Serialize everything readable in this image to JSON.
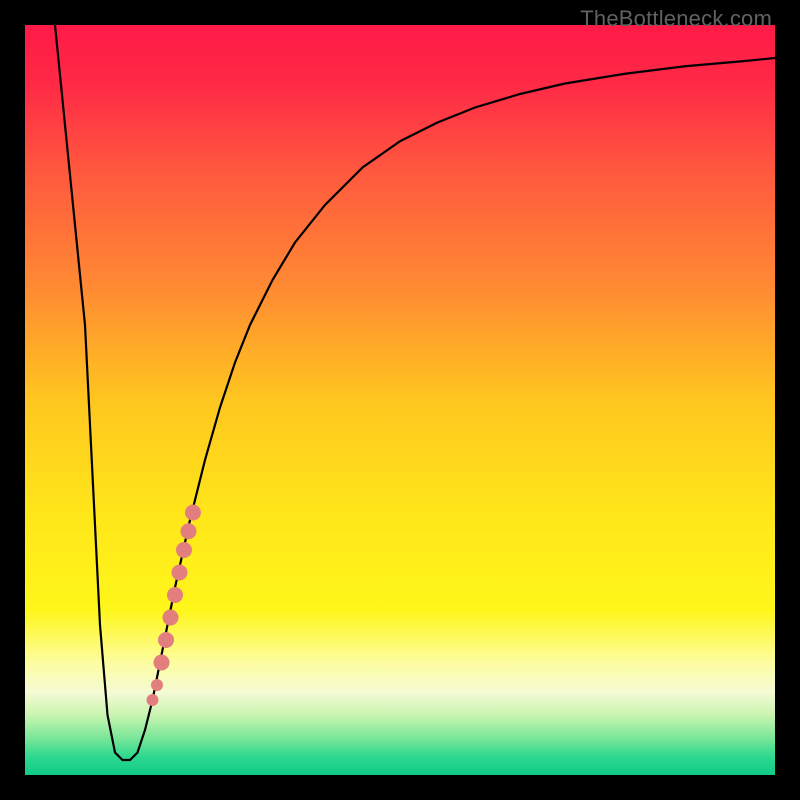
{
  "watermark": "TheBottleneck.com",
  "chart_data": {
    "type": "line",
    "title": "",
    "xlabel": "",
    "ylabel": "",
    "xlim": [
      0,
      100
    ],
    "ylim": [
      0,
      100
    ],
    "grid": false,
    "legend": false,
    "gradient_stops": [
      {
        "offset": 0.0,
        "color": "#ff1a47"
      },
      {
        "offset": 0.08,
        "color": "#ff2a46"
      },
      {
        "offset": 0.2,
        "color": "#ff5a3e"
      },
      {
        "offset": 0.35,
        "color": "#ff8a33"
      },
      {
        "offset": 0.5,
        "color": "#ffc61f"
      },
      {
        "offset": 0.65,
        "color": "#ffe61a"
      },
      {
        "offset": 0.78,
        "color": "#fff61a"
      },
      {
        "offset": 0.85,
        "color": "#fdfda0"
      },
      {
        "offset": 0.89,
        "color": "#f4fad4"
      },
      {
        "offset": 0.92,
        "color": "#c9f4b0"
      },
      {
        "offset": 0.95,
        "color": "#7ce79a"
      },
      {
        "offset": 0.975,
        "color": "#2fd98f"
      },
      {
        "offset": 1.0,
        "color": "#0fca87"
      }
    ],
    "series": [
      {
        "name": "bottleneck-curve",
        "color": "#000000",
        "x": [
          4,
          6,
          8,
          9,
          10,
          11,
          12,
          13,
          14,
          15,
          16,
          17,
          18,
          20,
          22,
          24,
          26,
          28,
          30,
          33,
          36,
          40,
          45,
          50,
          55,
          60,
          66,
          72,
          80,
          88,
          96,
          100
        ],
        "y": [
          100,
          80,
          60,
          40,
          20,
          8,
          3,
          2,
          2,
          3,
          6,
          10,
          15,
          25,
          34,
          42,
          49,
          55,
          60,
          66,
          71,
          76,
          81,
          84.5,
          87,
          89,
          90.8,
          92.2,
          93.5,
          94.5,
          95.2,
          95.6
        ]
      }
    ],
    "markers": {
      "name": "selected-range-dots",
      "color": "#e37e7e",
      "points": [
        {
          "x": 17.0,
          "y": 10.0,
          "r": 6
        },
        {
          "x": 17.6,
          "y": 12.0,
          "r": 6
        },
        {
          "x": 18.2,
          "y": 15.0,
          "r": 8
        },
        {
          "x": 18.8,
          "y": 18.0,
          "r": 8
        },
        {
          "x": 19.4,
          "y": 21.0,
          "r": 8
        },
        {
          "x": 20.0,
          "y": 24.0,
          "r": 8
        },
        {
          "x": 20.6,
          "y": 27.0,
          "r": 8
        },
        {
          "x": 21.2,
          "y": 30.0,
          "r": 8
        },
        {
          "x": 21.8,
          "y": 32.5,
          "r": 8
        },
        {
          "x": 22.4,
          "y": 35.0,
          "r": 8
        }
      ]
    }
  }
}
